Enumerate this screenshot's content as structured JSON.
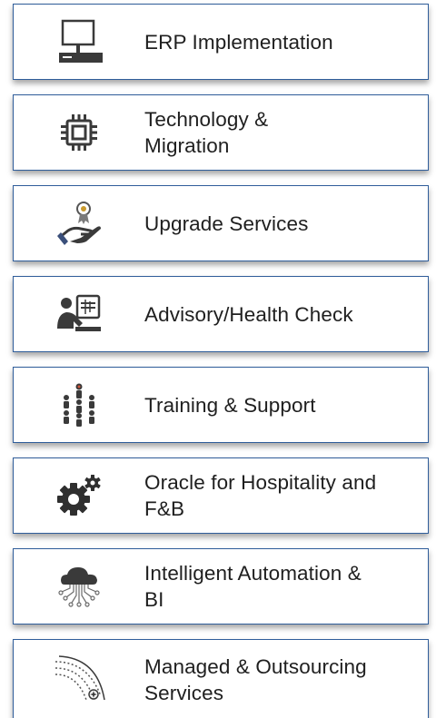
{
  "services": {
    "items": [
      {
        "label": "ERP Implementation",
        "icon": "computer-icon"
      },
      {
        "label": "Technology & Migration",
        "icon": "chip-icon"
      },
      {
        "label": "Upgrade Services",
        "icon": "hand-award-icon"
      },
      {
        "label": "Advisory/Health Check",
        "icon": "advisor-screen-icon"
      },
      {
        "label": "Training & Support",
        "icon": "people-group-icon"
      },
      {
        "label": "Oracle for Hospitality and F&B",
        "icon": "gears-icon"
      },
      {
        "label": "Intelligent Automation & BI",
        "icon": "cloud-circuit-icon"
      },
      {
        "label": "Managed & Outsourcing Services",
        "icon": "satellite-orbit-icon"
      }
    ]
  },
  "colors": {
    "border": "#2f5d9a",
    "text": "#1f1f1f",
    "icon_dark": "#3a3a3a"
  }
}
